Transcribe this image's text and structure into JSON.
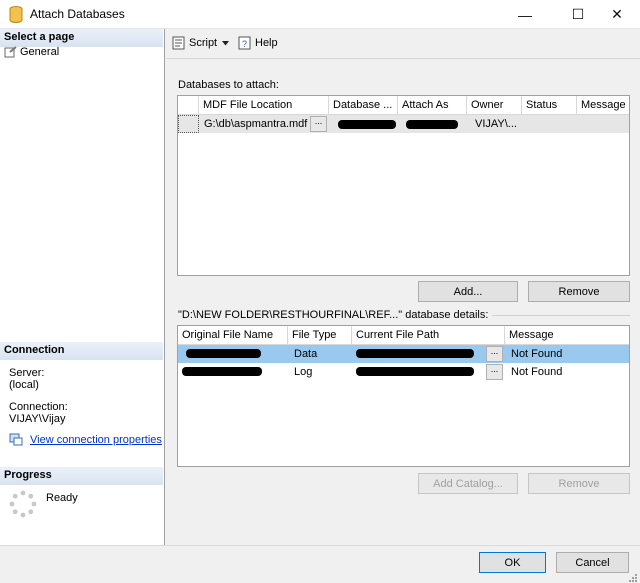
{
  "window": {
    "title": "Attach Databases",
    "minimize": "—",
    "maximize": "☐",
    "close": "✕"
  },
  "left": {
    "select_page_heading": "Select a page",
    "pages": [
      "General"
    ],
    "connection_heading": "Connection",
    "server_label": "Server:",
    "server_value": "(local)",
    "connection_label": "Connection:",
    "connection_value": "VIJAY\\Vijay",
    "view_props_link": "View connection properties",
    "progress_heading": "Progress",
    "progress_status": "Ready"
  },
  "toolbar": {
    "script_label": "Script",
    "help_label": "Help"
  },
  "attach": {
    "section_label": "Databases to attach:",
    "columns": [
      "MDF File Location",
      "Database ...",
      "Attach As",
      "Owner",
      "Status",
      "Message"
    ],
    "rows": [
      {
        "mdf": "G:\\db\\aspmantra.mdf",
        "browse": "...",
        "database": "",
        "attach_as": "",
        "owner": "VIJAY\\...",
        "status": "",
        "message": ""
      }
    ],
    "add_button": "Add...",
    "remove_button": "Remove"
  },
  "details": {
    "section_label": "\"D:\\NEW FOLDER\\RESTHOURFINAL\\REF...\" database details:",
    "columns": [
      "Original File Name",
      "File Type",
      "Current File Path",
      "Message"
    ],
    "rows": [
      {
        "original": "",
        "type": "Data",
        "path": "",
        "browse": "...",
        "message": "Not Found"
      },
      {
        "original": "",
        "type": "Log",
        "path": "",
        "browse": "...",
        "message": "Not Found"
      }
    ],
    "add_catalog_button": "Add Catalog...",
    "remove_button": "Remove"
  },
  "footer": {
    "ok_button": "OK",
    "cancel_button": "Cancel"
  }
}
